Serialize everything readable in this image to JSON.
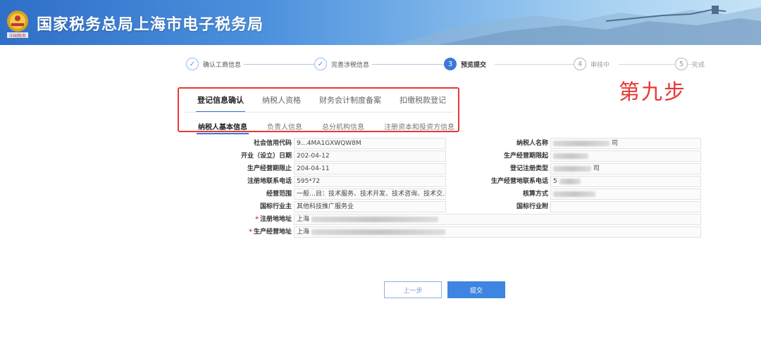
{
  "header": {
    "title": "国家税务总局上海市电子税务局"
  },
  "steps": [
    {
      "num": "✓",
      "label": "确认工商信息",
      "state": "done"
    },
    {
      "num": "✓",
      "label": "完善涉税信息",
      "state": "done"
    },
    {
      "num": "3",
      "label": "预览提交",
      "state": "active"
    },
    {
      "num": "4",
      "label": "审核中",
      "state": "todo"
    },
    {
      "num": "5",
      "label": "完成",
      "state": "todo"
    }
  ],
  "annotation": "第九步",
  "tabs_primary": [
    {
      "label": "登记信息确认",
      "active": true
    },
    {
      "label": "纳税人资格",
      "active": false
    },
    {
      "label": "财务会计制度备案",
      "active": false
    },
    {
      "label": "扣缴税款登记",
      "active": false
    }
  ],
  "tabs_secondary": [
    {
      "label": "纳税人基本信息",
      "active": true
    },
    {
      "label": "负责人信息",
      "active": false
    },
    {
      "label": "总分机构信息",
      "active": false
    },
    {
      "label": "注册资本和投资方信息",
      "active": false
    }
  ],
  "form": {
    "credit_code": {
      "label": "社会信用代码",
      "value": "9…4MA1GXWQW8M"
    },
    "taxpayer_name": {
      "label": "纳税人名称",
      "value": "司"
    },
    "open_date": {
      "label": "开业（设立）日期",
      "value": "202-04-12"
    },
    "period_start": {
      "label": "生产经营期限起",
      "value": ""
    },
    "period_end": {
      "label": "生产经营期限止",
      "value": "204-04-11"
    },
    "reg_type": {
      "label": "登记注册类型",
      "value": "司"
    },
    "reg_phone": {
      "label": "注册地联系电话",
      "value": "595*72"
    },
    "biz_phone": {
      "label": "生产经营地联系电话",
      "value": "5"
    },
    "scope": {
      "label": "经营范围",
      "value": "一般…目：技术服务、技术开发、技术咨询、技术交..."
    },
    "accounting": {
      "label": "核算方式",
      "value": ""
    },
    "industry_main": {
      "label": "国标行业主",
      "value": "其他科技推广服务业"
    },
    "industry_sub": {
      "label": "国标行业附",
      "value": ""
    },
    "reg_address": {
      "label": "注册地地址",
      "value": "上海",
      "required": "*"
    },
    "biz_address": {
      "label": "生产经营地址",
      "value": "上海",
      "required": "*"
    }
  },
  "buttons": {
    "prev": "上一步",
    "submit": "提交"
  }
}
